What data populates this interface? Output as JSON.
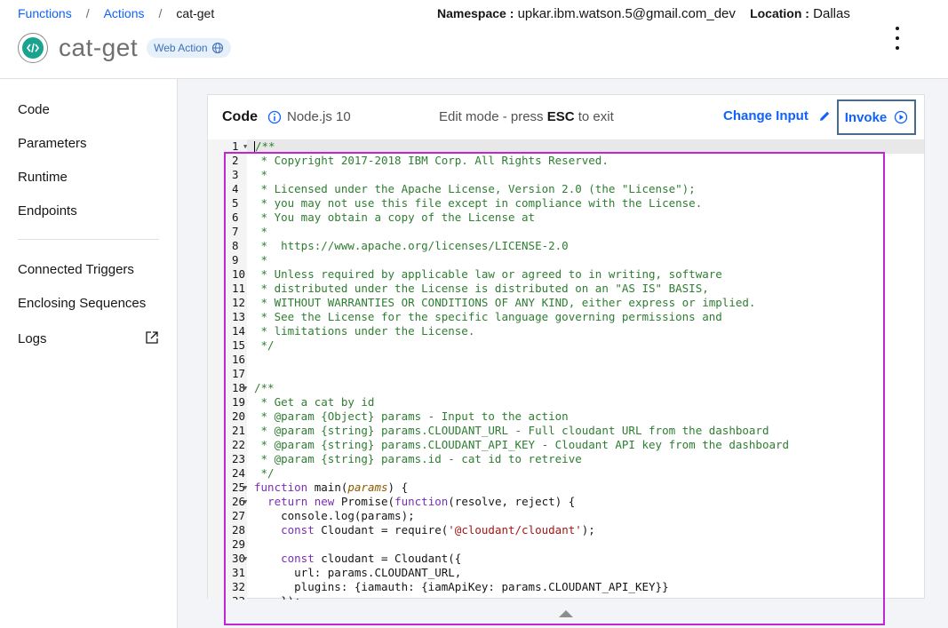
{
  "breadcrumb": {
    "functions": "Functions",
    "actions": "Actions",
    "current": "cat-get",
    "sep": "/"
  },
  "namespace": {
    "label": "Namespace :",
    "value": "upkar.ibm.watson.5@gmail.com_dev",
    "location_label": "Location :",
    "location_value": "Dallas"
  },
  "title": {
    "name": "cat-get",
    "tag": "Web Action"
  },
  "sidebar": {
    "items": [
      {
        "label": "Code"
      },
      {
        "label": "Parameters"
      },
      {
        "label": "Runtime"
      },
      {
        "label": "Endpoints"
      },
      {
        "label": "Connected Triggers"
      },
      {
        "label": "Enclosing Sequences"
      },
      {
        "label": "Logs"
      }
    ]
  },
  "editor_header": {
    "title": "Code",
    "runtime": "Node.js 10",
    "edit_mode_prefix": "Edit mode - press",
    "edit_mode_key": "ESC",
    "edit_mode_suffix": "to exit",
    "change_input": "Change Input",
    "invoke": "Invoke"
  },
  "code_lines": [
    "/**",
    " * Copyright 2017-2018 IBM Corp. All Rights Reserved.",
    " *",
    " * Licensed under the Apache License, Version 2.0 (the \"License\");",
    " * you may not use this file except in compliance with the License.",
    " * You may obtain a copy of the License at",
    " *",
    " *  https://www.apache.org/licenses/LICENSE-2.0",
    " *",
    " * Unless required by applicable law or agreed to in writing, software",
    " * distributed under the License is distributed on an \"AS IS\" BASIS,",
    " * WITHOUT WARRANTIES OR CONDITIONS OF ANY KIND, either express or implied.",
    " * See the License for the specific language governing permissions and",
    " * limitations under the License.",
    " */",
    "",
    "",
    "/**",
    " * Get a cat by id",
    " * @param {Object} params - Input to the action",
    " * @param {string} params.CLOUDANT_URL - Full cloudant URL from the dashboard",
    " * @param {string} params.CLOUDANT_API_KEY - Cloudant API key from the dashboard",
    " * @param {string} params.id - cat id to retreive",
    " */",
    "function main(params) {",
    "  return new Promise(function(resolve, reject) {",
    "    console.log(params);",
    "    const Cloudant = require('@cloudant/cloudant');",
    "",
    "    const cloudant = Cloudant({",
    "      url: params.CLOUDANT_URL,",
    "      plugins: {iamauth: {iamApiKey: params.CLOUDANT_API_KEY}}",
    "    });"
  ],
  "fold_lines": [
    1,
    18,
    25,
    26,
    30
  ],
  "colors": {
    "accent": "#0f62fe",
    "comment": "#2e7d32",
    "keyword": "#7a2fb3",
    "string": "#a31515",
    "highlight": "#c026d3"
  }
}
